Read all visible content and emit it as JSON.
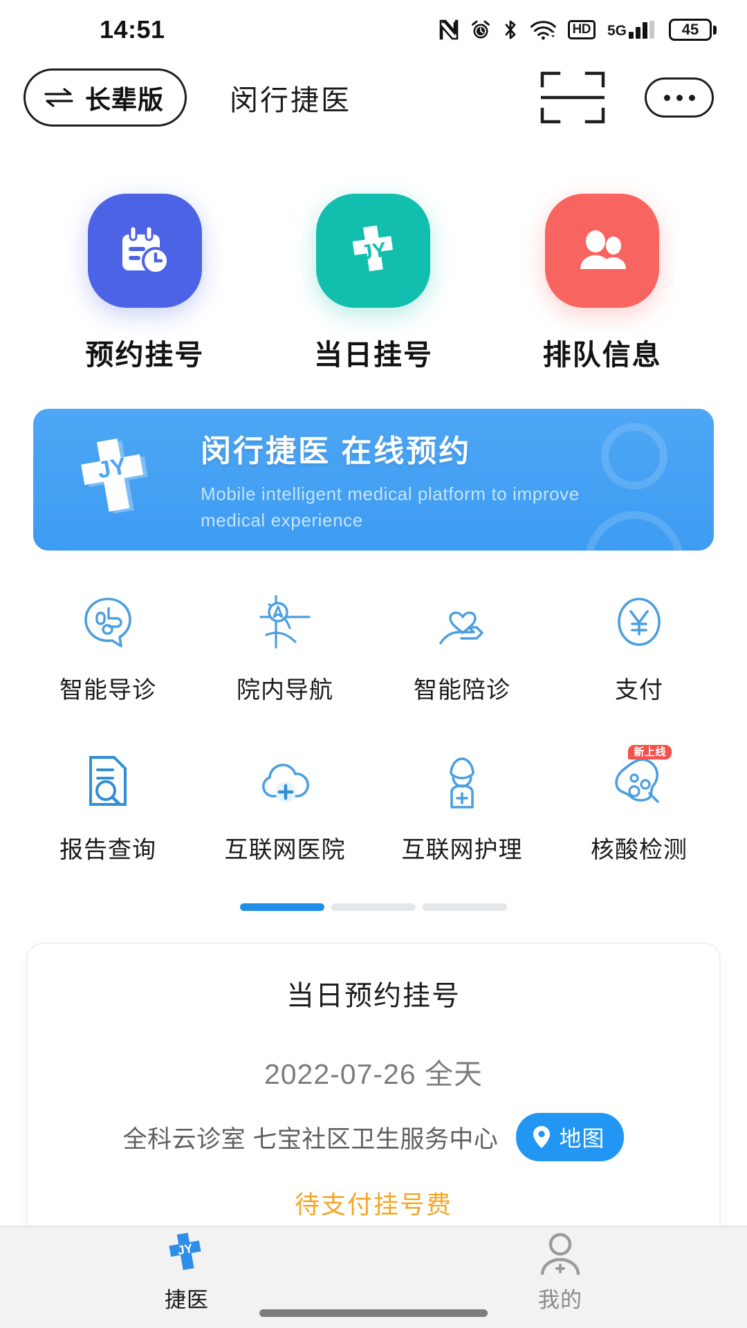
{
  "status_bar": {
    "time": "14:51",
    "battery_percent": "45",
    "network_label": "5G",
    "hd_label": "HD",
    "icons": [
      "nfc-icon",
      "alarm-icon",
      "bluetooth-icon",
      "wifi-icon",
      "hd-icon",
      "signal-icon",
      "battery-icon"
    ]
  },
  "app_bar": {
    "elder_mode_label": "长辈版",
    "title": "闵行捷医",
    "scan_icon": "scan-icon",
    "more_icon": "more-icon"
  },
  "entries": [
    {
      "label": "预约挂号",
      "color": "#4c63e6",
      "icon": "calendar-clock-icon"
    },
    {
      "label": "当日挂号",
      "color": "#12bfae",
      "icon": "medical-cross-jy-icon"
    },
    {
      "label": "排队信息",
      "color": "#f8645f",
      "icon": "people-queue-icon"
    }
  ],
  "banner": {
    "title": "闵行捷医 在线预约",
    "subtitle": "Mobile intelligent medical platform to improve medical experience",
    "background_color": "#4ea6f5"
  },
  "services": [
    {
      "label": "智能导诊",
      "icon": "smart-triage-icon",
      "badge": ""
    },
    {
      "label": "院内导航",
      "icon": "hospital-navigation-icon",
      "badge": ""
    },
    {
      "label": "智能陪诊",
      "icon": "smart-escort-icon",
      "badge": ""
    },
    {
      "label": "支付",
      "icon": "payment-yuan-icon",
      "badge": ""
    },
    {
      "label": "报告查询",
      "icon": "report-search-icon",
      "badge": ""
    },
    {
      "label": "互联网医院",
      "icon": "internet-hospital-icon",
      "badge": ""
    },
    {
      "label": "互联网护理",
      "icon": "internet-nursing-icon",
      "badge": ""
    },
    {
      "label": "核酸检测",
      "icon": "nucleic-acid-test-icon",
      "badge": "新上线"
    }
  ],
  "pagination": {
    "total": 3,
    "active": 1
  },
  "appointment_card": {
    "title": "当日预约挂号",
    "date": "2022-07-26 全天",
    "department": "全科云诊室 七宝社区卫生服务中心",
    "map_button_label": "地图",
    "status": "待支付挂号费",
    "status_color": "#f5a623"
  },
  "tabbar": [
    {
      "label": "捷医",
      "icon": "jieyi-logo-icon",
      "active": true
    },
    {
      "label": "我的",
      "icon": "profile-icon",
      "active": false
    }
  ]
}
